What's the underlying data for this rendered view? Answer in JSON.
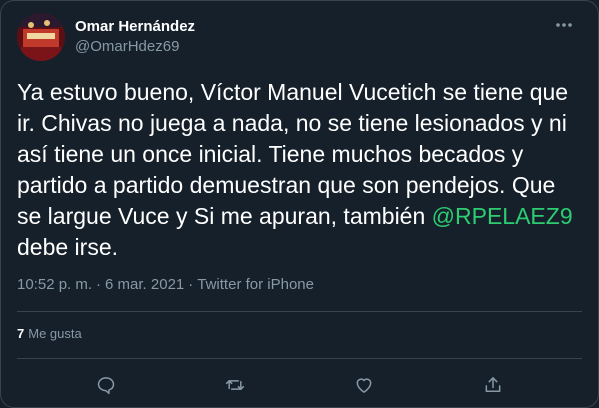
{
  "author": {
    "display_name": "Omar Hernández",
    "handle": "@OmarHdez69"
  },
  "tweet": {
    "text_before": "Ya estuvo bueno, Víctor Manuel Vucetich se tiene que\nir. Chivas no juega a nada, no se tiene lesionados y ni\nasí tiene un once inicial. Tiene muchos becados y\npartido a partido demuestran que son pendejos. Que\nse largue Vuce y Si me apuran, también ",
    "mention": "@RPELAEZ9",
    "text_after": "\ndebe irse."
  },
  "meta": {
    "time": "10:52 p. m.",
    "sep1": "·",
    "date": "6 mar. 2021",
    "sep2": "·",
    "source": "Twitter for iPhone"
  },
  "stats": {
    "likes_count": "7",
    "likes_label": "Me gusta"
  },
  "icons": {
    "more": "more-icon",
    "reply": "reply-icon",
    "retweet": "retweet-icon",
    "like": "like-icon",
    "share": "share-icon"
  },
  "colors": {
    "background": "#15202b",
    "secondary_text": "#8899a6",
    "mention": "#2ecc71",
    "border": "#38444d"
  }
}
